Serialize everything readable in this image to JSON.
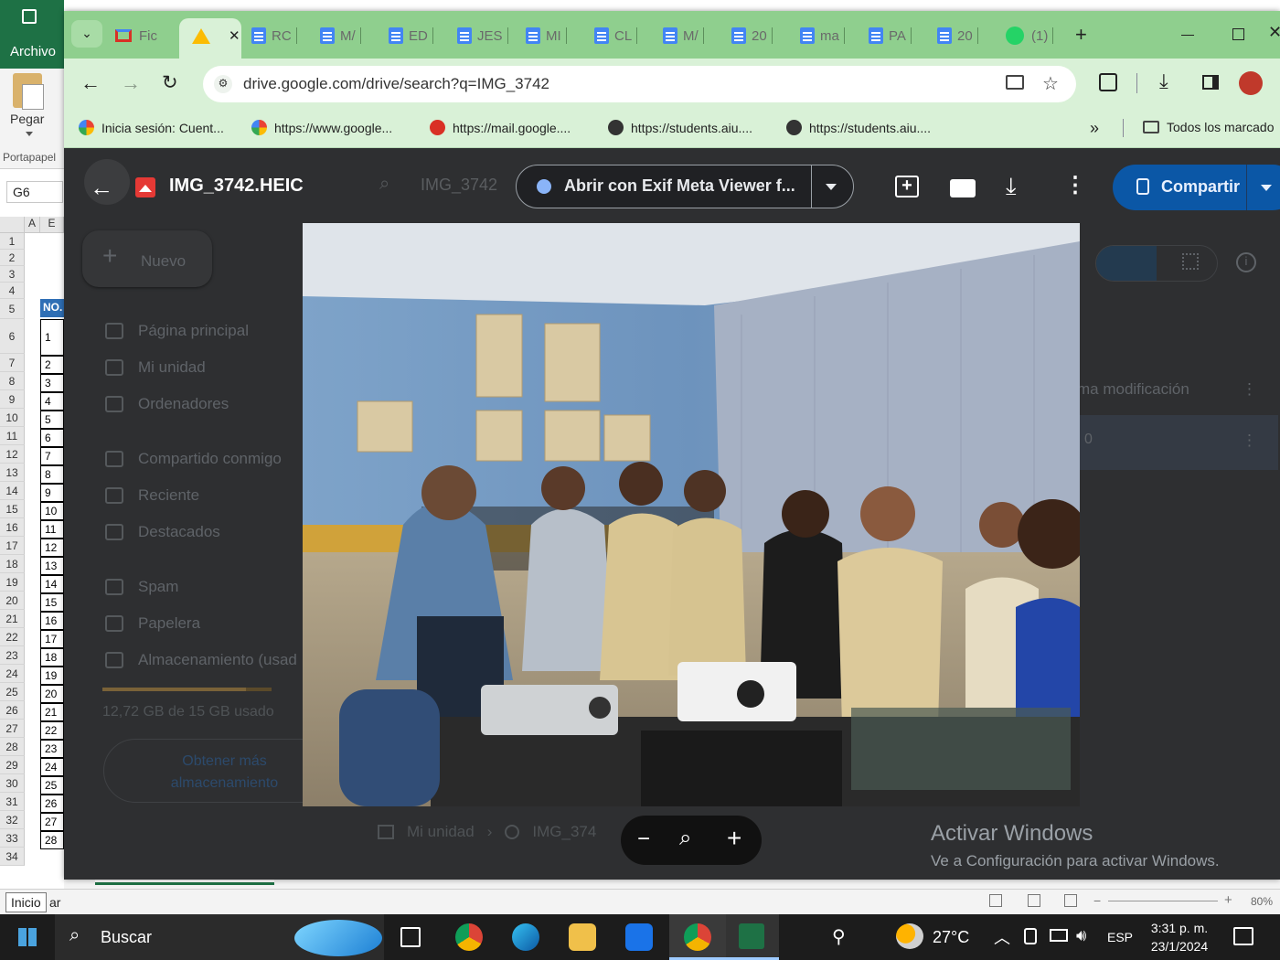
{
  "excel": {
    "menu_archivo": "Archivo",
    "pegar": "Pegar",
    "portapapeles": "Portapapel",
    "namebox": "G6",
    "col_a": "A",
    "col_b": "E",
    "no_header": "NO.",
    "rows": [
      "1",
      "2",
      "3",
      "4",
      "5",
      "6",
      "7",
      "8",
      "9",
      "10",
      "11",
      "12",
      "13",
      "14",
      "15",
      "16",
      "17",
      "18",
      "19",
      "20",
      "21",
      "22",
      "23",
      "24",
      "25",
      "26",
      "27",
      "28",
      "29",
      "30",
      "31",
      "32",
      "33",
      "34"
    ],
    "numbers": [
      "1",
      "2",
      "3",
      "4",
      "5",
      "6",
      "7",
      "8",
      "9",
      "10",
      "11",
      "12",
      "13",
      "14",
      "15",
      "16",
      "17",
      "18",
      "19",
      "20",
      "21",
      "22",
      "23",
      "24",
      "25",
      "26",
      "27",
      "28"
    ],
    "status_inicio": "Inicio",
    "status_ar": "ar",
    "zoom": "80%"
  },
  "chrome": {
    "tabs": [
      {
        "label": "Fic",
        "icon": "gmail-icon"
      },
      {
        "label": "",
        "icon": "drive-icon"
      },
      {
        "label": "RC",
        "icon": "docs-icon"
      },
      {
        "label": "M/",
        "icon": "docs-icon"
      },
      {
        "label": "ED",
        "icon": "docs-icon"
      },
      {
        "label": "JES",
        "icon": "docs-icon"
      },
      {
        "label": "MI",
        "icon": "docs-icon"
      },
      {
        "label": "CL",
        "icon": "docs-icon"
      },
      {
        "label": "M/",
        "icon": "docs-icon"
      },
      {
        "label": "20",
        "icon": "docs-icon"
      },
      {
        "label": "ma",
        "icon": "docs-icon"
      },
      {
        "label": "PA",
        "icon": "docs-icon"
      },
      {
        "label": "20",
        "icon": "docs-icon"
      },
      {
        "label": "(1)",
        "icon": "whatsapp-icon"
      }
    ],
    "url": "drive.google.com/drive/search?q=IMG_3742",
    "bookmarks": [
      {
        "label": "Inicia sesión: Cuent...",
        "icon": "google-icon"
      },
      {
        "label": "https://www.google...",
        "icon": "google-icon"
      },
      {
        "label": "https://mail.google....",
        "icon": "gmail-icon"
      },
      {
        "label": "https://students.aiu....",
        "icon": "globe-icon"
      },
      {
        "label": "https://students.aiu....",
        "icon": "globe-icon"
      }
    ],
    "all_bookmarks": "Todos los marcado"
  },
  "drive": {
    "search_text": "IMG_3742",
    "new_button": "Nuevo",
    "sidebar": [
      {
        "label": "Página principal",
        "icon": "home-icon"
      },
      {
        "label": "Mi unidad",
        "icon": "drive-folder-icon"
      },
      {
        "label": "Ordenadores",
        "icon": "computer-icon"
      },
      {
        "label": "Compartido conmigo",
        "icon": "people-icon"
      },
      {
        "label": "Reciente",
        "icon": "clock-icon"
      },
      {
        "label": "Destacados",
        "icon": "star-icon"
      },
      {
        "label": "Spam",
        "icon": "spam-icon"
      },
      {
        "label": "Papelera",
        "icon": "trash-icon"
      },
      {
        "label": "Almacenamiento (usad",
        "icon": "cloud-icon"
      }
    ],
    "storage": "12,72 GB de 15 GB usado",
    "storage_fill": 0.848,
    "get_more_1": "Obtener más",
    "get_more_2": "almacenamiento",
    "modified_col": "ma modificación",
    "row_partial": "0",
    "breadcrumb_drive": "Mi unidad",
    "breadcrumb_file": "IMG_374"
  },
  "viewer": {
    "file_name": "IMG_3742.HEIC",
    "open_with": "Abrir con Exif Meta Viewer f...",
    "share": "Compartir"
  },
  "windows_watermark": {
    "title": "Activar Windows",
    "subtitle": "Ve a Configuración para activar Windows."
  },
  "taskbar": {
    "search": "Buscar",
    "temperature": "27°C",
    "language": "ESP",
    "time": "3:31 p. m.",
    "date": "23/1/2024"
  }
}
